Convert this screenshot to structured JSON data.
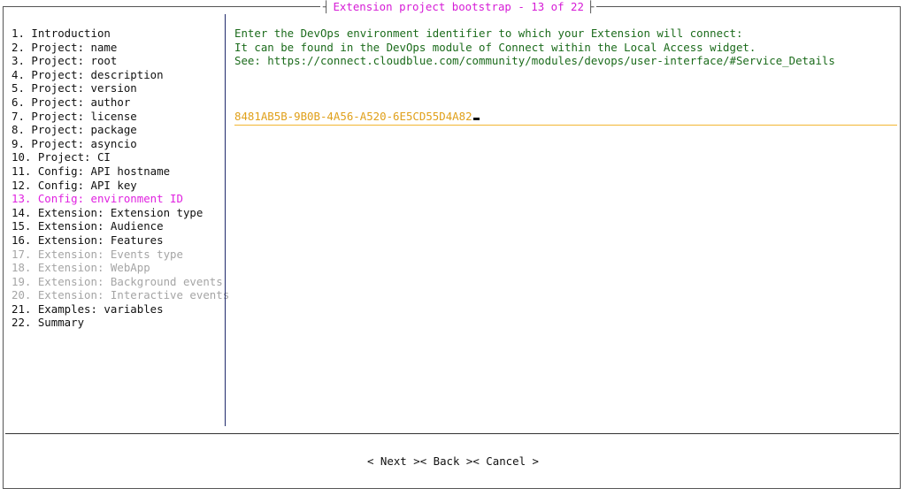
{
  "window": {
    "title": "Extension project bootstrap - 13 of 22"
  },
  "sidebar": {
    "items": [
      {
        "label": "1. Introduction",
        "state": "normal"
      },
      {
        "label": "2. Project: name",
        "state": "normal"
      },
      {
        "label": "3. Project: root",
        "state": "normal"
      },
      {
        "label": "4. Project: description",
        "state": "normal"
      },
      {
        "label": "5. Project: version",
        "state": "normal"
      },
      {
        "label": "6. Project: author",
        "state": "normal"
      },
      {
        "label": "7. Project: license",
        "state": "normal"
      },
      {
        "label": "8. Project: package",
        "state": "normal"
      },
      {
        "label": "9. Project: asyncio",
        "state": "normal"
      },
      {
        "label": "10. Project: CI",
        "state": "normal"
      },
      {
        "label": "11. Config: API hostname",
        "state": "normal"
      },
      {
        "label": "12. Config: API key",
        "state": "normal"
      },
      {
        "label": "13. Config: environment ID",
        "state": "active"
      },
      {
        "label": "14. Extension: Extension type",
        "state": "normal"
      },
      {
        "label": "15. Extension: Audience",
        "state": "normal"
      },
      {
        "label": "16. Extension: Features",
        "state": "normal"
      },
      {
        "label": "17. Extension: Events type",
        "state": "disabled"
      },
      {
        "label": "18. Extension: WebApp",
        "state": "disabled"
      },
      {
        "label": "19. Extension: Background events",
        "state": "disabled"
      },
      {
        "label": "20. Extension: Interactive events",
        "state": "disabled"
      },
      {
        "label": "21. Examples: variables",
        "state": "normal"
      },
      {
        "label": "22. Summary",
        "state": "normal"
      }
    ]
  },
  "main": {
    "description": [
      "Enter the DevOps environment identifier to which your Extension will connect:",
      "It can be found in the DevOps module of Connect within the Local Access widget.",
      "See: https://connect.cloudblue.com/community/modules/devops/user-interface/#Service_Details"
    ],
    "input_value": "8481AB5B-9B0B-4A56-A520-6E5CD55D4A82"
  },
  "buttons": {
    "next": "< Next >",
    "back": "< Back >",
    "cancel": "< Cancel >"
  },
  "colors": {
    "active_item": "#e022e0",
    "disabled_item": "#a5a5a5",
    "description_text": "#1b6b1b",
    "input_text": "#e0a01a",
    "input_underline": "#f2b632",
    "title": "#d61cd6"
  }
}
